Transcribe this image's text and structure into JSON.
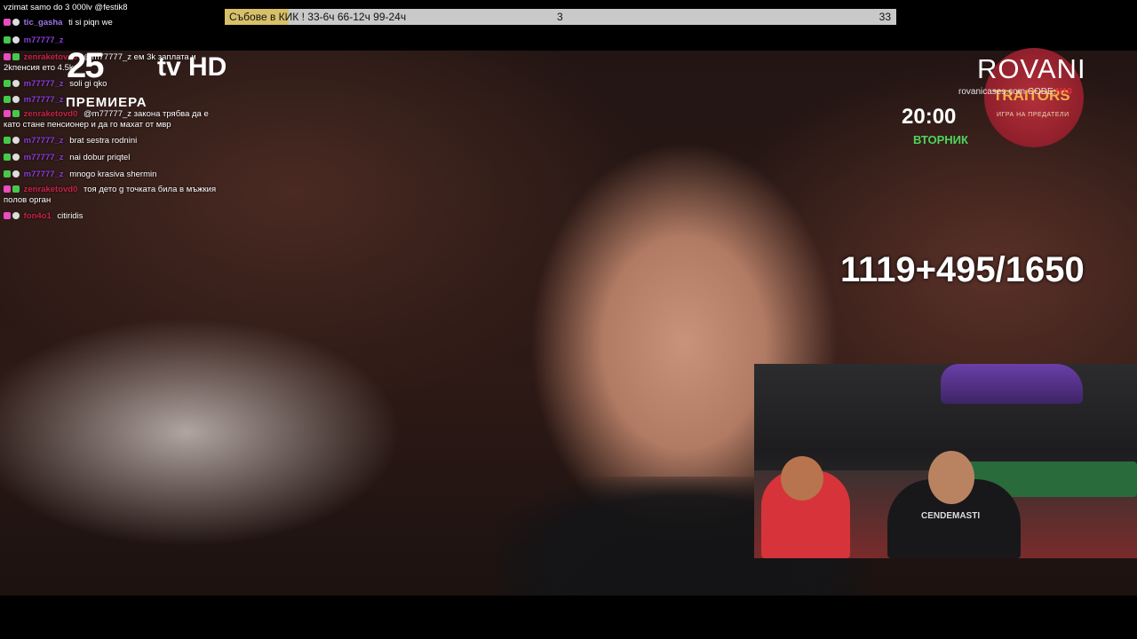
{
  "ticker": {
    "text": "Събове в КИК ! 33-6ч 66-12ч 99-24ч",
    "middle": "3",
    "right": "33",
    "highlight_color": "#d8c06a"
  },
  "chat": {
    "top_line": "vzimat samo do 3 000lv @festik8",
    "messages": [
      {
        "user": "tic_gasha",
        "text": "ti si piqn we"
      },
      {
        "user": "m77777_z",
        "text": ""
      },
      {
        "user": "zenraketovd0",
        "text": "@m77777_z ем 3k заплата и 2kпенсия ето 4.5k"
      },
      {
        "user": "m77777_z",
        "text": "soli gi qko"
      },
      {
        "user": "m77777_z",
        "text": ""
      },
      {
        "user": "zenraketovd0",
        "text": "@m77777_z закона трябва да е като стане пенсионер и да го махат от мвр"
      },
      {
        "user": "m77777_z",
        "text": "brat sestra rodnini"
      },
      {
        "user": "m77777_z",
        "text": "nai dobur priqtel"
      },
      {
        "user": "m77777_z",
        "text": "mnogo krasiva shermin"
      },
      {
        "user": "zenraketovd0",
        "text": "тоя дето g точката била в мъжкия полов орган"
      },
      {
        "user": "fon4o1",
        "text": "citiridis"
      }
    ]
  },
  "channel": {
    "number": "25",
    "name": "tv HD",
    "premiere": "ПРЕМИЕРА"
  },
  "promo": {
    "sponsor": "ROVANI",
    "code_text": "rovanicases.com CODE:",
    "code_value": "N10",
    "show_title": "TRAITORS",
    "show_subtitle": "ИГРА НА ПРЕДАТЕЛИ",
    "time": "20:00",
    "day": "ВТОРНИК",
    "day_color": "#4fd45a"
  },
  "counter": "1119+495/1650",
  "webcam": {
    "shirt_text": "CENDEMASTI"
  },
  "icons": [
    "heart-badge-icon",
    "sub-badge-icon",
    "emote-icon"
  ]
}
